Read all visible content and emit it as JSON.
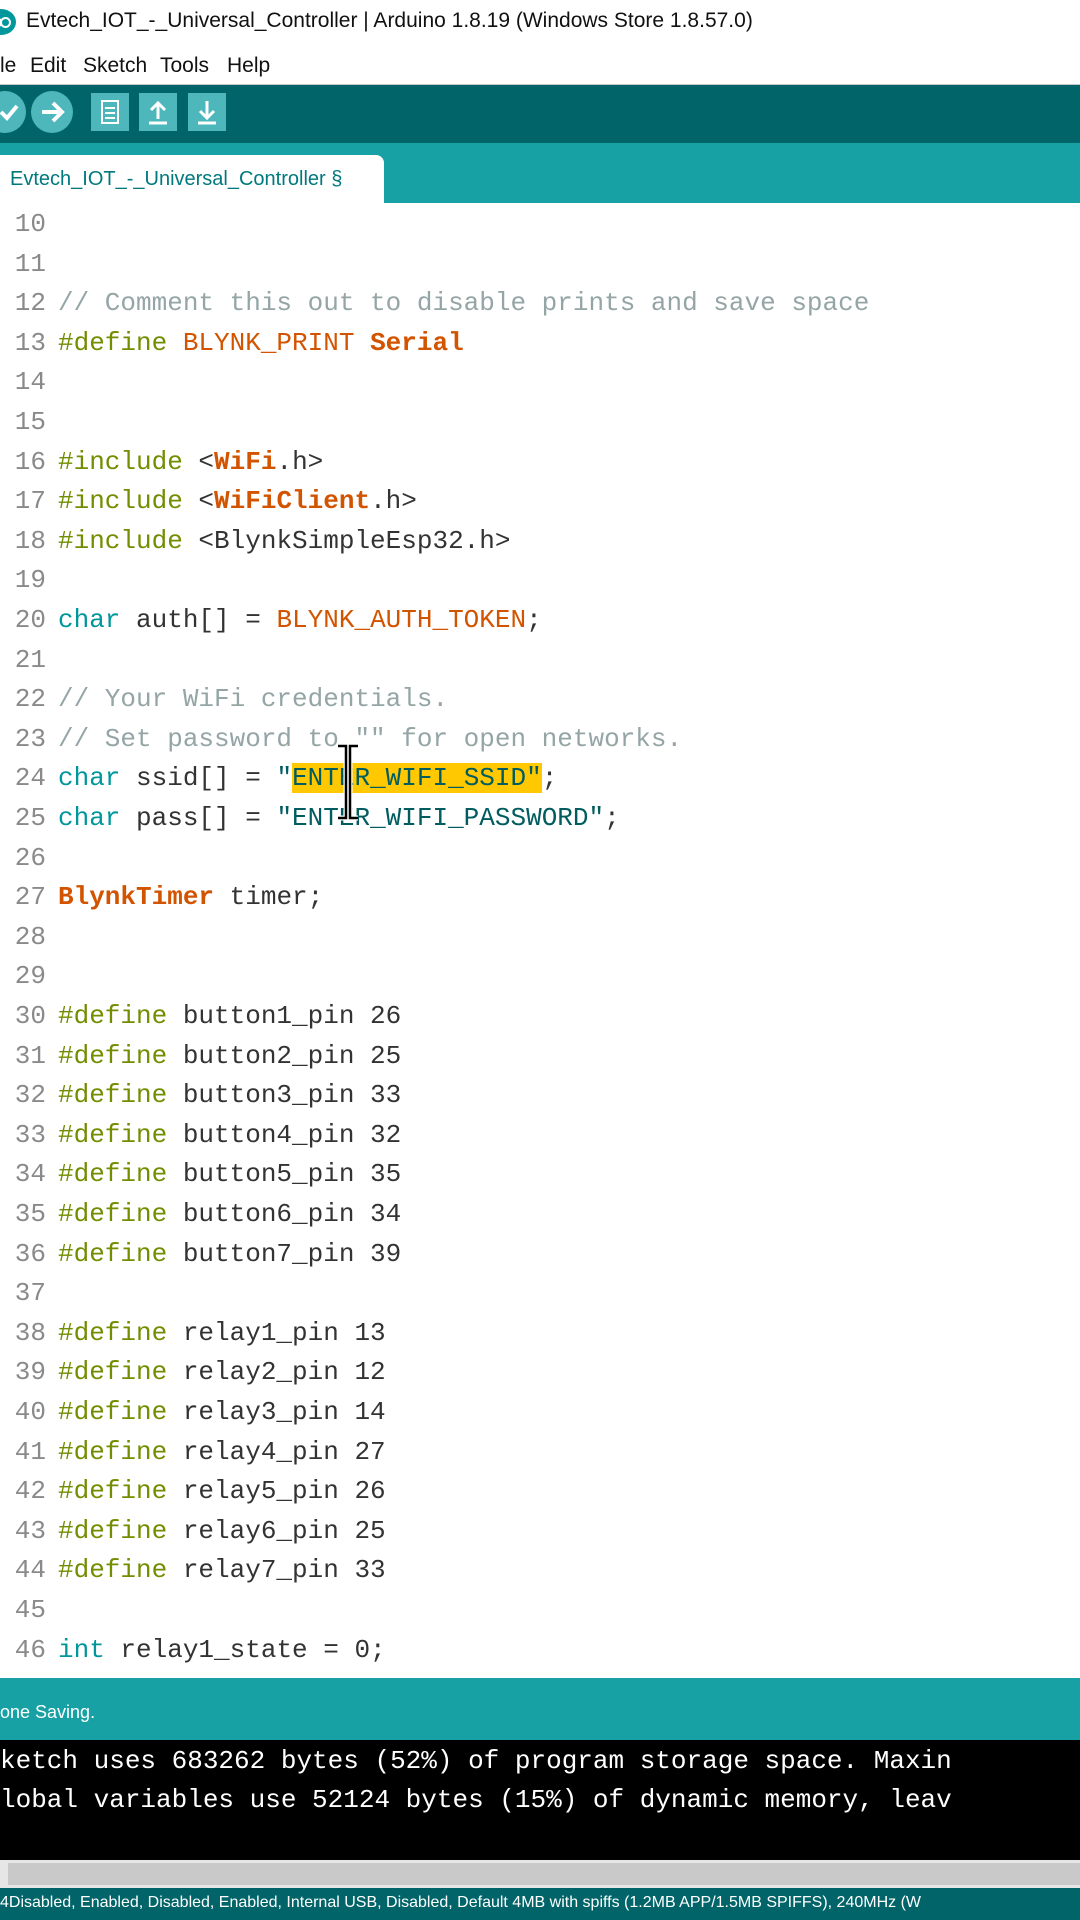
{
  "window": {
    "title": "Evtech_IOT_-_Universal_Controller | Arduino 1.8.19 (Windows Store 1.8.57.0)"
  },
  "menu": {
    "items": [
      "le",
      "Edit",
      "Sketch",
      "Tools",
      "Help"
    ]
  },
  "toolbar": {
    "buttons": [
      "verify-icon",
      "upload-icon",
      "new-icon",
      "open-icon",
      "save-icon"
    ]
  },
  "tab": {
    "label": "Evtech_IOT_-_Universal_Controller §"
  },
  "editor": {
    "lines": [
      {
        "n": "10",
        "tokens": []
      },
      {
        "n": "11",
        "tokens": []
      },
      {
        "n": "12",
        "tokens": [
          [
            "cm",
            "// Comment this out to disable prints and save space"
          ]
        ]
      },
      {
        "n": "13",
        "tokens": [
          [
            "pp",
            "#define"
          ],
          [
            "",
            ""
          ],
          [
            "",
            ""
          ],
          [
            "or",
            " BLYNK_PRINT "
          ],
          [
            "ob",
            "Serial"
          ]
        ]
      },
      {
        "n": "14",
        "tokens": []
      },
      {
        "n": "15",
        "tokens": []
      },
      {
        "n": "16",
        "tokens": [
          [
            "pp",
            "#include"
          ],
          [
            "",
            " <"
          ],
          [
            "ob",
            "WiFi"
          ],
          [
            "",
            ".h>"
          ]
        ]
      },
      {
        "n": "17",
        "tokens": [
          [
            "pp",
            "#include"
          ],
          [
            "",
            " <"
          ],
          [
            "ob",
            "WiFiClient"
          ],
          [
            "",
            ".h>"
          ]
        ]
      },
      {
        "n": "18",
        "tokens": [
          [
            "pp",
            "#include"
          ],
          [
            "",
            " <BlynkSimpleEsp32.h>"
          ]
        ]
      },
      {
        "n": "19",
        "tokens": []
      },
      {
        "n": "20",
        "tokens": [
          [
            "ty",
            "char"
          ],
          [
            "",
            " auth[] = "
          ],
          [
            "or",
            "BLYNK_AUTH_TOKEN"
          ],
          [
            "",
            ";"
          ]
        ]
      },
      {
        "n": "21",
        "tokens": []
      },
      {
        "n": "22",
        "tokens": [
          [
            "cm",
            "// Your WiFi credentials."
          ]
        ]
      },
      {
        "n": "23",
        "tokens": [
          [
            "cm",
            "// Set password to \"\" for open networks."
          ]
        ]
      },
      {
        "n": "24",
        "tokens": [
          [
            "ty",
            "char"
          ],
          [
            "",
            " ssid[] = "
          ],
          [
            "bl",
            "\""
          ],
          [
            "sel",
            "ENTER_WIFI_SSID\""
          ],
          [
            "",
            ";"
          ]
        ]
      },
      {
        "n": "25",
        "tokens": [
          [
            "ty",
            "char"
          ],
          [
            "",
            " pass[] = "
          ],
          [
            "bl",
            "\"ENTER_WIFI_PASSWORD\""
          ],
          [
            "",
            ";"
          ]
        ]
      },
      {
        "n": "26",
        "tokens": []
      },
      {
        "n": "27",
        "tokens": [
          [
            "ob",
            "BlynkTimer"
          ],
          [
            "",
            " timer;"
          ]
        ]
      },
      {
        "n": "28",
        "tokens": []
      },
      {
        "n": "29",
        "tokens": []
      },
      {
        "n": "30",
        "tokens": [
          [
            "pp",
            "#define"
          ],
          [
            "",
            " button1_pin 26"
          ]
        ]
      },
      {
        "n": "31",
        "tokens": [
          [
            "pp",
            "#define"
          ],
          [
            "",
            " button2_pin 25"
          ]
        ]
      },
      {
        "n": "32",
        "tokens": [
          [
            "pp",
            "#define"
          ],
          [
            "",
            " button3_pin 33"
          ]
        ]
      },
      {
        "n": "33",
        "tokens": [
          [
            "pp",
            "#define"
          ],
          [
            "",
            " button4_pin 32"
          ]
        ]
      },
      {
        "n": "34",
        "tokens": [
          [
            "pp",
            "#define"
          ],
          [
            "",
            " button5_pin 35"
          ]
        ]
      },
      {
        "n": "35",
        "tokens": [
          [
            "pp",
            "#define"
          ],
          [
            "",
            " button6_pin 34"
          ]
        ]
      },
      {
        "n": "36",
        "tokens": [
          [
            "pp",
            "#define"
          ],
          [
            "",
            " button7_pin 39"
          ]
        ]
      },
      {
        "n": "37",
        "tokens": []
      },
      {
        "n": "38",
        "tokens": [
          [
            "pp",
            "#define"
          ],
          [
            "",
            " relay1_pin 13"
          ]
        ]
      },
      {
        "n": "39",
        "tokens": [
          [
            "pp",
            "#define"
          ],
          [
            "",
            " relay2_pin 12"
          ]
        ]
      },
      {
        "n": "40",
        "tokens": [
          [
            "pp",
            "#define"
          ],
          [
            "",
            " relay3_pin 14"
          ]
        ]
      },
      {
        "n": "41",
        "tokens": [
          [
            "pp",
            "#define"
          ],
          [
            "",
            " relay4_pin 27"
          ]
        ]
      },
      {
        "n": "42",
        "tokens": [
          [
            "pp",
            "#define"
          ],
          [
            "",
            " relay5_pin 26"
          ]
        ]
      },
      {
        "n": "43",
        "tokens": [
          [
            "pp",
            "#define"
          ],
          [
            "",
            " relay6_pin 25"
          ]
        ]
      },
      {
        "n": "44",
        "tokens": [
          [
            "pp",
            "#define"
          ],
          [
            "",
            " relay7_pin 33"
          ]
        ]
      },
      {
        "n": "45",
        "tokens": []
      },
      {
        "n": "46",
        "tokens": [
          [
            "ty",
            "int"
          ],
          [
            "",
            " relay1_state = 0;"
          ]
        ]
      }
    ]
  },
  "status": {
    "message": "one Saving."
  },
  "console": {
    "lines": [
      "ketch uses 683262 bytes (52%) of program storage space. Maxin",
      "lobal variables use 52124 bytes (15%) of dynamic memory, leav"
    ]
  },
  "board": {
    "text": "4Disabled, Enabled, Disabled, Enabled, Internal USB, Disabled, Default 4MB with spiffs (1.2MB APP/1.5MB SPIFFS), 240MHz (W"
  },
  "colors": {
    "toolbar": "#006468",
    "tabstrip": "#17a1a5",
    "selection": "#ffc800",
    "keyword_type": "#00979c",
    "keyword_preprocessor": "#728e00",
    "constant": "#d35400",
    "comment": "#95a5a6"
  }
}
